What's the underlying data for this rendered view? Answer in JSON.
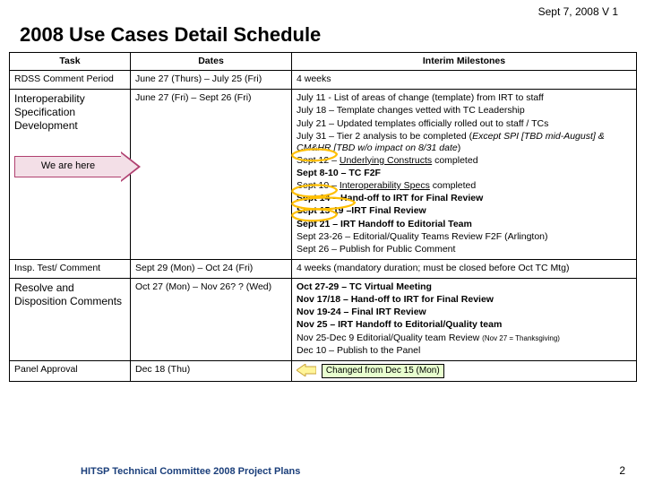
{
  "header_date": "Sept 7, 2008 V 1",
  "title": "2008 Use Cases Detail Schedule",
  "columns": {
    "c1": "Task",
    "c2": "Dates",
    "c3": "Interim Milestones"
  },
  "rows": {
    "r1": {
      "task": "RDSS Comment Period",
      "dates": "June 27 (Thurs) – July 25 (Fri)",
      "ms": {
        "a": "4 weeks"
      }
    },
    "r2": {
      "task": "Interoperability Specification Development",
      "dates": "June 27 (Fri) – Sept 26 (Fri)",
      "callout": "We are here",
      "ms": {
        "a": "July 11 - List of areas of change (template) from IRT to staff",
        "b": "July 18 – Template changes vetted with TC Leadership",
        "c": "July 21 – Updated templates officially rolled out to staff / TCs",
        "d_pre": "July 31 – Tier 2 analysis to be completed (",
        "d_i": "Except SPI [TBD mid-August] & CM&HR [TBD w/o impact on 8/31 date",
        "d_post": ")",
        "e_pre": "Sept 12 – ",
        "e_u": "Underlying Constructs",
        "e_post": " completed",
        "f_b": "Sept 8-10 – TC F2F",
        "g_pre": "Sept 10 – ",
        "g_u": "Interoperability Specs",
        "g_post": " completed",
        "h_b": "Sept 14 – Hand-off to IRT for Final Review",
        "i_b": "Sept 15-19 –IRT Final Review",
        "j_b": "Sept 21 – IRT Handoff to Editorial Team",
        "k": "Sept 23-26 – Editorial/Quality Teams Review F2F (Arlington)",
        "l": "Sept 26 – Publish for Public Comment"
      }
    },
    "r3": {
      "task": "Insp. Test/ Comment",
      "dates": "Sept 29 (Mon) – Oct 24 (Fri)",
      "ms": {
        "a": "4 weeks (mandatory duration; must be closed before Oct TC Mtg)"
      }
    },
    "r4": {
      "task": "Resolve and Disposition Comments",
      "dates": "Oct 27 (Mon) – Nov  26? ? (Wed)",
      "ms": {
        "a_b": "Oct 27-29 – TC Virtual Meeting",
        "b_b": "Nov 17/18 – Hand-off to IRT for Final Review",
        "c_b": "Nov 19-24 – Final IRT Review",
        "d_b": "Nov 25 – IRT Handoff to Editorial/Quality team",
        "e_pre": "Nov 25-Dec 9 Editorial/Quality team Review ",
        "e_small": "(Nov 27 = Thanksgiving)",
        "f": "Dec 10 – Publish to the Panel"
      }
    },
    "r5": {
      "task": "Panel Approval",
      "dates": "Dec 18 (Thu)",
      "changed": "Changed from Dec 15 (Mon)"
    }
  },
  "footer": "HITSP Technical Committee 2008 Project Plans",
  "page": "2"
}
